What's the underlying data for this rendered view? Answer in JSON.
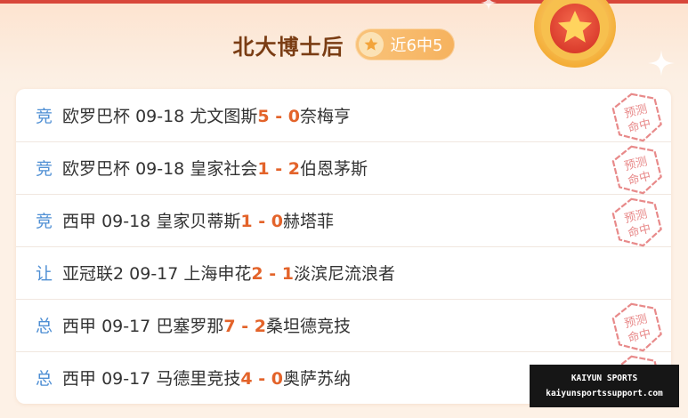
{
  "header": {
    "title": "北大博士后",
    "record": "近6中5",
    "star_icon": "star-icon",
    "medal_icon": "star-medal-icon"
  },
  "colors": {
    "accent": "#e3632a",
    "title": "#7a3d14",
    "tag": "#4f8fd4",
    "stamp": "#e88a8a"
  },
  "matches": [
    {
      "tag": "竞",
      "league": "欧罗巴杯",
      "date": "09-18",
      "home": "尤文图斯",
      "home_score": "5",
      "sep": " - ",
      "away_score": "0",
      "away": "奈梅亨",
      "hit": true,
      "stamp": "预测命中"
    },
    {
      "tag": "竞",
      "league": "欧罗巴杯",
      "date": "09-18",
      "home": "皇家社会",
      "home_score": "1",
      "sep": " - ",
      "away_score": "2",
      "away": "伯恩茅斯",
      "hit": true,
      "stamp": "预测命中"
    },
    {
      "tag": "竞",
      "league": "西甲",
      "date": "09-18",
      "home": "皇家贝蒂斯",
      "home_score": "1",
      "sep": " - ",
      "away_score": "0",
      "away": "赫塔菲",
      "hit": true,
      "stamp": "预测命中"
    },
    {
      "tag": "让",
      "league": "亚冠联2",
      "date": "09-17",
      "home": "上海申花",
      "home_score": "2",
      "sep": " - ",
      "away_score": "1",
      "away": "淡滨尼流浪者",
      "hit": false,
      "stamp": ""
    },
    {
      "tag": "总",
      "league": "西甲",
      "date": "09-17",
      "home": "巴塞罗那",
      "home_score": "7",
      "sep": " - ",
      "away_score": "2",
      "away": "桑坦德竞技",
      "hit": true,
      "stamp": "预测命中"
    },
    {
      "tag": "总",
      "league": "西甲",
      "date": "09-17",
      "home": "马德里竞技",
      "home_score": "4",
      "sep": " - ",
      "away_score": "0",
      "away": "奥萨苏纳",
      "hit": true,
      "stamp": "预测命中"
    }
  ],
  "watermark": {
    "line1": "KAIYUN SPORTS",
    "line2": "kaiyunsportssupport.com"
  }
}
